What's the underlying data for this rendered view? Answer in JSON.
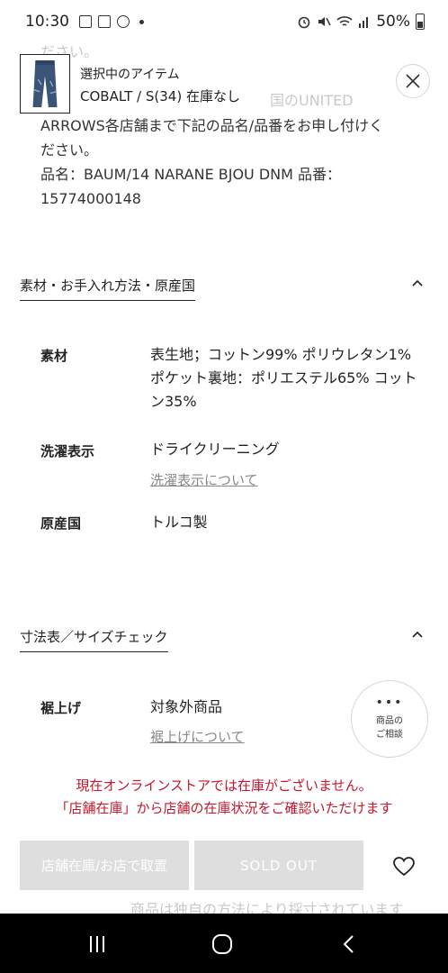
{
  "status_bar": {
    "time": "10:30",
    "battery": "50%"
  },
  "selected_item": {
    "label": "選択中のアイテム",
    "variant": "COBALT / S(34) 在庫なし",
    "thumbnail_icon": "jeans-thumbnail"
  },
  "ghost_text": {
    "line_top": "ださい。",
    "line_mid": "国のUNITED"
  },
  "description": {
    "lines": [
      "ARROWS各店舗まで下記の品名/品番をお申し付けく",
      "ださい。",
      "品名：BAUM/14 NARANE BJOU DNM 品番：",
      "15774000148"
    ]
  },
  "sections": {
    "material": {
      "title": "素材・お手入れ方法・原産国",
      "rows": {
        "material_key": "素材",
        "material_val": "表生地；コットン99% ポリウレタン1% ポケット裏地：ポリエステル65% コットン35%",
        "wash_key": "洗濯表示",
        "wash_val": "ドライクリーニング",
        "wash_link": "洗濯表示について",
        "origin_key": "原産国",
        "origin_val": "トルコ製"
      }
    },
    "size": {
      "title": "寸法表／サイズチェック",
      "hem_key": "裾上げ",
      "hem_val": "対象外商品",
      "hem_link": "裾上げについて"
    }
  },
  "consult": {
    "dots": "•••",
    "line1": "商品の",
    "line2": "ご相談"
  },
  "notice": {
    "line1": "現在オンラインストアでは在庫がございません。",
    "line2": "「店舗在庫」から店舗の在庫状況をご確認いただけます"
  },
  "buttons": {
    "store": "店舗在庫/お店で取置",
    "soldout": "SOLD OUT"
  },
  "ghost_bottom": {
    "line1": "商品は独自の方法により採寸されています"
  },
  "colors": {
    "notice_red": "#c7162b",
    "button_grey": "#dedede"
  }
}
